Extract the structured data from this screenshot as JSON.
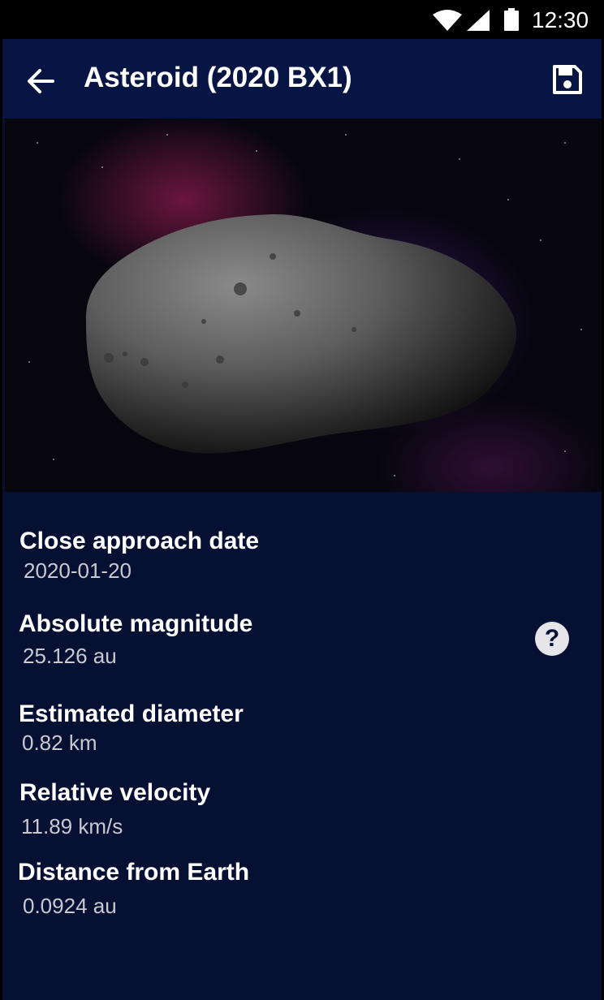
{
  "status_bar": {
    "time": "12:30",
    "icons": [
      "wifi-icon",
      "cell-signal-icon",
      "battery-icon"
    ]
  },
  "app_bar": {
    "title": "Asteroid (2020 BX1)",
    "back_icon": "arrow-back-icon",
    "save_icon": "save-icon"
  },
  "details": {
    "items": [
      {
        "label": "Close approach date",
        "value": "2020-01-20"
      },
      {
        "label": "Absolute magnitude",
        "value": "25.126 au"
      },
      {
        "label": "Estimated diameter",
        "value": "0.82 km"
      },
      {
        "label": "Relative velocity",
        "value": "11.89 km/s"
      },
      {
        "label": "Distance from Earth",
        "value": "0.0924 au"
      }
    ],
    "help_glyph": "?"
  },
  "colors": {
    "app_bar": "#061543",
    "background": "#061033",
    "status_bar": "#000000",
    "value_text": "#c9c9cf"
  }
}
